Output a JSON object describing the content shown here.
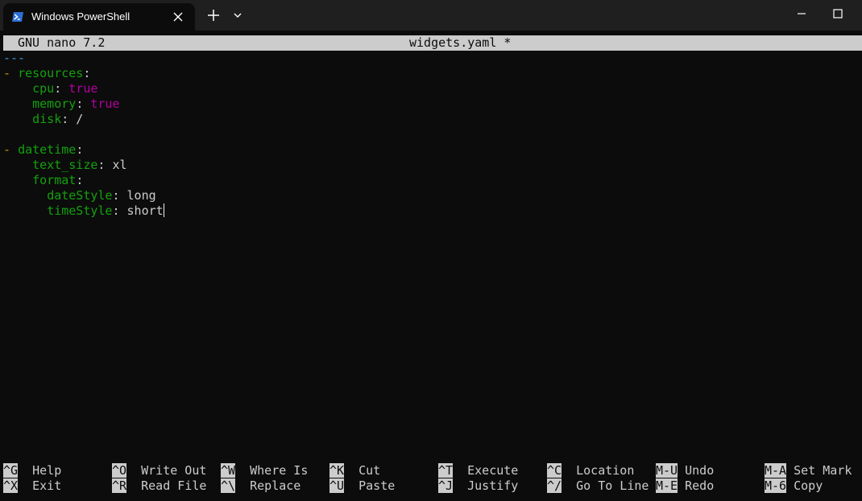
{
  "window": {
    "tab_title": "Windows PowerShell",
    "icons": {
      "tab": "powershell-icon",
      "close": "close-icon",
      "new_tab": "plus-icon",
      "dropdown": "chevron-down-icon",
      "minimize": "minimize-icon",
      "maximize": "maximize-icon"
    }
  },
  "nano": {
    "version": "GNU nano 7.2",
    "filename": "widgets.yaml *",
    "lines": [
      {
        "parts": [
          {
            "text": "---",
            "kind": "doc"
          }
        ]
      },
      {
        "parts": [
          {
            "text": "- ",
            "kind": "dash"
          },
          {
            "text": "resources",
            "kind": "key"
          },
          {
            "text": ":",
            "kind": "plain"
          }
        ]
      },
      {
        "parts": [
          {
            "text": "    ",
            "kind": "plain"
          },
          {
            "text": "cpu",
            "kind": "key"
          },
          {
            "text": ": ",
            "kind": "plain"
          },
          {
            "text": "true",
            "kind": "bool"
          }
        ]
      },
      {
        "parts": [
          {
            "text": "    ",
            "kind": "plain"
          },
          {
            "text": "memory",
            "kind": "key"
          },
          {
            "text": ": ",
            "kind": "plain"
          },
          {
            "text": "true",
            "kind": "bool"
          }
        ]
      },
      {
        "parts": [
          {
            "text": "    ",
            "kind": "plain"
          },
          {
            "text": "disk",
            "kind": "key"
          },
          {
            "text": ": /",
            "kind": "plain"
          }
        ]
      },
      {
        "parts": []
      },
      {
        "parts": [
          {
            "text": "- ",
            "kind": "dash"
          },
          {
            "text": "datetime",
            "kind": "key"
          },
          {
            "text": ":",
            "kind": "plain"
          }
        ]
      },
      {
        "parts": [
          {
            "text": "    ",
            "kind": "plain"
          },
          {
            "text": "text_size",
            "kind": "key"
          },
          {
            "text": ": xl",
            "kind": "plain"
          }
        ]
      },
      {
        "parts": [
          {
            "text": "    ",
            "kind": "plain"
          },
          {
            "text": "format",
            "kind": "key"
          },
          {
            "text": ":",
            "kind": "plain"
          }
        ]
      },
      {
        "parts": [
          {
            "text": "      ",
            "kind": "plain"
          },
          {
            "text": "dateStyle",
            "kind": "key"
          },
          {
            "text": ": long",
            "kind": "plain"
          }
        ]
      },
      {
        "parts": [
          {
            "text": "      ",
            "kind": "plain"
          },
          {
            "text": "timeStyle",
            "kind": "key"
          },
          {
            "text": ": short",
            "kind": "plain"
          }
        ],
        "cursor": true
      }
    ],
    "shortcuts": [
      {
        "key": "^G",
        "label": "Help"
      },
      {
        "key": "^O",
        "label": "Write Out"
      },
      {
        "key": "^W",
        "label": "Where Is"
      },
      {
        "key": "^K",
        "label": "Cut"
      },
      {
        "key": "^T",
        "label": "Execute"
      },
      {
        "key": "^C",
        "label": "Location"
      },
      {
        "key": "M-U",
        "label": "Undo"
      },
      {
        "key": "M-A",
        "label": "Set Mark"
      },
      {
        "key": "^X",
        "label": "Exit"
      },
      {
        "key": "^R",
        "label": "Read File"
      },
      {
        "key": "^\\",
        "label": "Replace"
      },
      {
        "key": "^U",
        "label": "Paste"
      },
      {
        "key": "^J",
        "label": "Justify"
      },
      {
        "key": "^/",
        "label": "Go To Line"
      },
      {
        "key": "M-E",
        "label": "Redo"
      },
      {
        "key": "M-6",
        "label": "Copy"
      }
    ]
  }
}
